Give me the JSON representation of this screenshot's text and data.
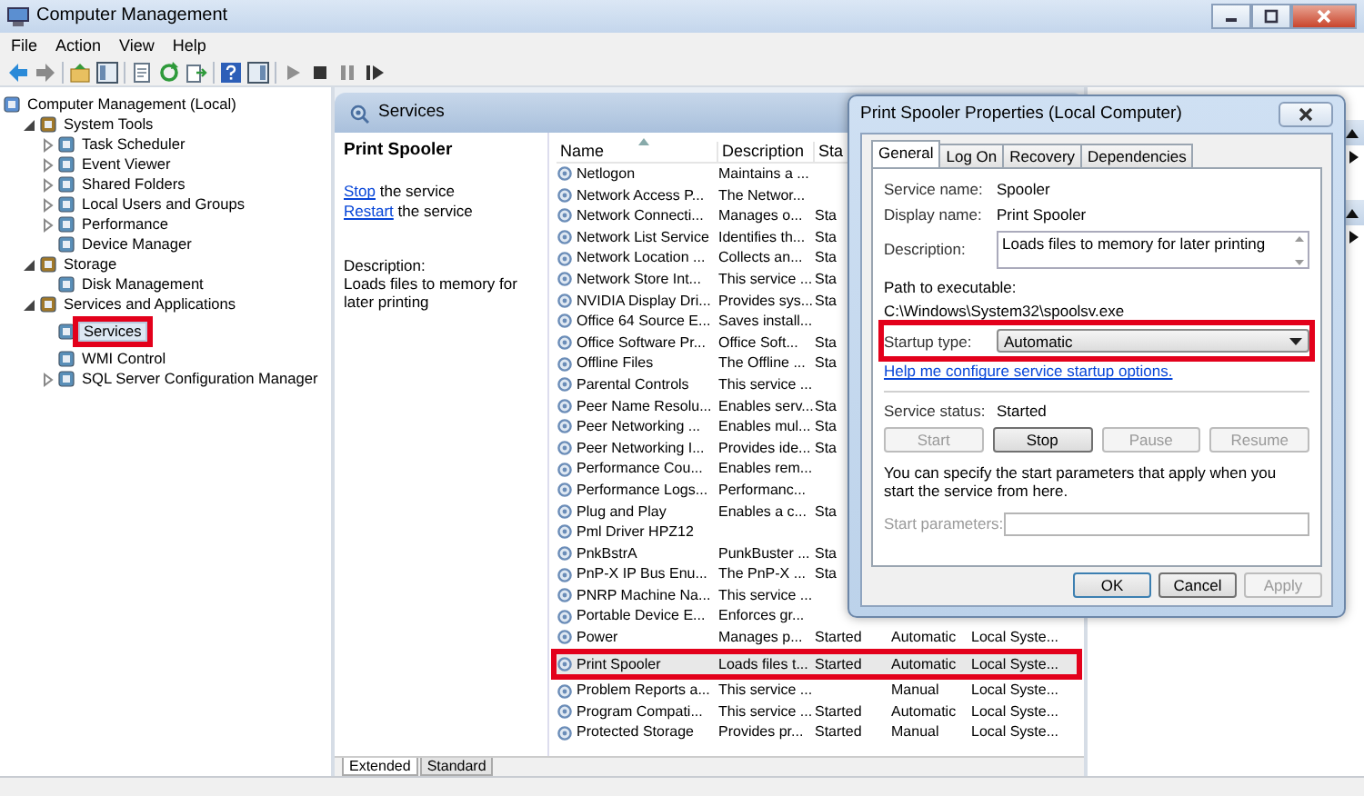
{
  "window": {
    "title": "Computer Management"
  },
  "menu": [
    "File",
    "Action",
    "View",
    "Help"
  ],
  "tree": [
    {
      "label": "Computer Management (Local)",
      "selected": false,
      "highlighted": false,
      "children": [
        {
          "label": "System Tools",
          "expanded": true,
          "selected": false,
          "highlighted": false,
          "children": [
            {
              "label": "Task Scheduler",
              "expanded": false,
              "selected": false,
              "highlighted": false
            },
            {
              "label": "Event Viewer",
              "expanded": false,
              "selected": false,
              "highlighted": false
            },
            {
              "label": "Shared Folders",
              "expanded": false,
              "selected": false,
              "highlighted": false
            },
            {
              "label": "Local Users and Groups",
              "expanded": false,
              "selected": false,
              "highlighted": false
            },
            {
              "label": "Performance",
              "expanded": false,
              "selected": false,
              "highlighted": false
            },
            {
              "label": "Device Manager",
              "selected": false,
              "highlighted": false
            }
          ]
        },
        {
          "label": "Storage",
          "expanded": true,
          "selected": false,
          "highlighted": false,
          "children": [
            {
              "label": "Disk Management",
              "selected": false,
              "highlighted": false
            }
          ]
        },
        {
          "label": "Services and Applications",
          "expanded": true,
          "selected": false,
          "highlighted": false,
          "children": [
            {
              "label": "Services",
              "selected": true,
              "highlighted": true
            },
            {
              "label": "WMI Control",
              "selected": false,
              "highlighted": false
            },
            {
              "label": "SQL Server Configuration Manager",
              "expanded": false,
              "selected": false,
              "highlighted": false
            }
          ]
        }
      ]
    }
  ],
  "middle": {
    "header": "Services",
    "service_name": "Print Spooler",
    "actions": [
      {
        "link": "Stop",
        "rest": " the service"
      },
      {
        "link": "Restart",
        "rest": " the service"
      }
    ],
    "description_label": "Description:",
    "description": "Loads files to memory for later printing"
  },
  "list": {
    "columns": [
      "Name",
      "Description",
      "Sta"
    ],
    "rows": [
      {
        "name": "Netlogon",
        "description": "Maintains a ...",
        "status": "",
        "startup_type": "",
        "log_on_as": "",
        "selected": false,
        "highlighted": false
      },
      {
        "name": "Network Access P...",
        "description": "The Networ...",
        "status": "",
        "startup_type": "",
        "log_on_as": "",
        "selected": false,
        "highlighted": false
      },
      {
        "name": "Network Connecti...",
        "description": "Manages o...",
        "status": "Sta",
        "startup_type": "",
        "log_on_as": "",
        "selected": false,
        "highlighted": false
      },
      {
        "name": "Network List Service",
        "description": "Identifies th...",
        "status": "Sta",
        "startup_type": "",
        "log_on_as": "",
        "selected": false,
        "highlighted": false
      },
      {
        "name": "Network Location ...",
        "description": "Collects an...",
        "status": "Sta",
        "startup_type": "",
        "log_on_as": "",
        "selected": false,
        "highlighted": false
      },
      {
        "name": "Network Store Int...",
        "description": "This service ...",
        "status": "Sta",
        "startup_type": "",
        "log_on_as": "",
        "selected": false,
        "highlighted": false
      },
      {
        "name": "NVIDIA Display Dri...",
        "description": "Provides sys...",
        "status": "Sta",
        "startup_type": "",
        "log_on_as": "",
        "selected": false,
        "highlighted": false
      },
      {
        "name": "Office 64 Source E...",
        "description": "Saves install...",
        "status": "",
        "startup_type": "",
        "log_on_as": "",
        "selected": false,
        "highlighted": false
      },
      {
        "name": "Office Software Pr...",
        "description": "Office Soft...",
        "status": "Sta",
        "startup_type": "",
        "log_on_as": "",
        "selected": false,
        "highlighted": false
      },
      {
        "name": "Offline Files",
        "description": "The Offline ...",
        "status": "Sta",
        "startup_type": "",
        "log_on_as": "",
        "selected": false,
        "highlighted": false
      },
      {
        "name": "Parental Controls",
        "description": "This service ...",
        "status": "",
        "startup_type": "",
        "log_on_as": "",
        "selected": false,
        "highlighted": false
      },
      {
        "name": "Peer Name Resolu...",
        "description": "Enables serv...",
        "status": "Sta",
        "startup_type": "",
        "log_on_as": "",
        "selected": false,
        "highlighted": false
      },
      {
        "name": "Peer Networking ...",
        "description": "Enables mul...",
        "status": "Sta",
        "startup_type": "",
        "log_on_as": "",
        "selected": false,
        "highlighted": false
      },
      {
        "name": "Peer Networking I...",
        "description": "Provides ide...",
        "status": "Sta",
        "startup_type": "",
        "log_on_as": "",
        "selected": false,
        "highlighted": false
      },
      {
        "name": "Performance Cou...",
        "description": "Enables rem...",
        "status": "",
        "startup_type": "",
        "log_on_as": "",
        "selected": false,
        "highlighted": false
      },
      {
        "name": "Performance Logs...",
        "description": "Performanc...",
        "status": "",
        "startup_type": "",
        "log_on_as": "",
        "selected": false,
        "highlighted": false
      },
      {
        "name": "Plug and Play",
        "description": "Enables a c...",
        "status": "Sta",
        "startup_type": "",
        "log_on_as": "",
        "selected": false,
        "highlighted": false
      },
      {
        "name": "Pml Driver HPZ12",
        "description": "",
        "status": "",
        "startup_type": "",
        "log_on_as": "",
        "selected": false,
        "highlighted": false
      },
      {
        "name": "PnkBstrA",
        "description": "PunkBuster ...",
        "status": "Sta",
        "startup_type": "",
        "log_on_as": "",
        "selected": false,
        "highlighted": false
      },
      {
        "name": "PnP-X IP Bus Enu...",
        "description": "The PnP-X ...",
        "status": "Sta",
        "startup_type": "",
        "log_on_as": "",
        "selected": false,
        "highlighted": false
      },
      {
        "name": "PNRP Machine Na...",
        "description": "This service ...",
        "status": "",
        "startup_type": "",
        "log_on_as": "",
        "selected": false,
        "highlighted": false
      },
      {
        "name": "Portable Device E...",
        "description": "Enforces gr...",
        "status": "",
        "startup_type": "",
        "log_on_as": "",
        "selected": false,
        "highlighted": false
      },
      {
        "name": "Power",
        "description": "Manages p...",
        "status": "Started",
        "startup_type": "Automatic",
        "log_on_as": "Local Syste...",
        "selected": false,
        "highlighted": false
      },
      {
        "name": "Print Spooler",
        "description": "Loads files t...",
        "status": "Started",
        "startup_type": "Automatic",
        "log_on_as": "Local Syste...",
        "selected": true,
        "highlighted": true
      },
      {
        "name": "Problem Reports a...",
        "description": "This service ...",
        "status": "",
        "startup_type": "Manual",
        "log_on_as": "Local Syste...",
        "selected": false,
        "highlighted": false
      },
      {
        "name": "Program Compati...",
        "description": "This service ...",
        "status": "Started",
        "startup_type": "Automatic",
        "log_on_as": "Local Syste...",
        "selected": false,
        "highlighted": false
      },
      {
        "name": "Protected Storage",
        "description": "Provides pr...",
        "status": "Started",
        "startup_type": "Manual",
        "log_on_as": "Local Syste...",
        "selected": false,
        "highlighted": false
      }
    ]
  },
  "view_tabs": [
    {
      "label": "Extended",
      "selected": true
    },
    {
      "label": "Standard",
      "selected": false
    }
  ],
  "dialog": {
    "title": "Print Spooler Properties (Local Computer)",
    "tabs": [
      {
        "label": "General",
        "selected": true
      },
      {
        "label": "Log On",
        "selected": false
      },
      {
        "label": "Recovery",
        "selected": false
      },
      {
        "label": "Dependencies",
        "selected": false
      }
    ],
    "service_name": {
      "label": "Service name:",
      "value": "Spooler"
    },
    "display_name": {
      "label": "Display name:",
      "value": "Print Spooler"
    },
    "description": {
      "label": "Description:",
      "value": "Loads files to memory for later printing"
    },
    "path": {
      "label": "Path to executable:",
      "value": "C:\\Windows\\System32\\spoolsv.exe"
    },
    "startup_type": {
      "label": "Startup type:",
      "value": "Automatic",
      "highlighted": true
    },
    "help_link": "Help me configure service startup options.",
    "service_status": {
      "label": "Service status:",
      "value": "Started"
    },
    "service_buttons": [
      {
        "label": "Start",
        "disabled": true
      },
      {
        "label": "Stop",
        "disabled": false
      },
      {
        "label": "Pause",
        "disabled": true
      },
      {
        "label": "Resume",
        "disabled": true
      }
    ],
    "note": "You can specify the start parameters that apply when you start the service from here.",
    "start_parameters": {
      "label": "Start parameters:",
      "disabled": true
    },
    "buttons": [
      {
        "label": "OK",
        "disabled": false
      },
      {
        "label": "Cancel",
        "disabled": false
      },
      {
        "label": "Apply",
        "disabled": true
      }
    ]
  }
}
